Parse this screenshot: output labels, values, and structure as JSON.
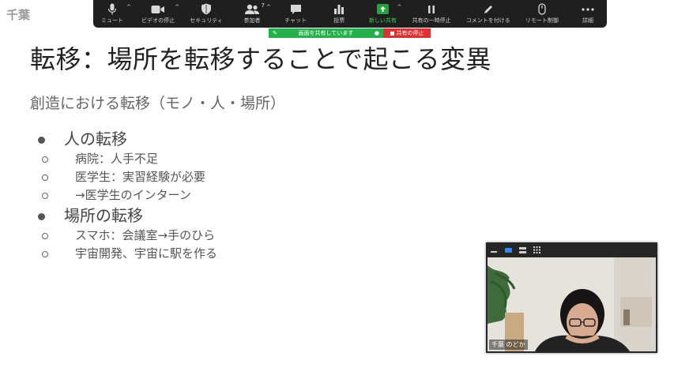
{
  "screen_owner": "千葉",
  "toolbar": {
    "items": [
      {
        "label": "ミュート",
        "icon": "microphone-icon",
        "caret": true
      },
      {
        "label": "ビデオの停止",
        "icon": "video-camera-icon",
        "caret": true
      },
      {
        "label": "セキュリティ",
        "icon": "shield-icon"
      },
      {
        "label": "参加者",
        "icon": "participants-icon",
        "badge": "7",
        "caret": true
      },
      {
        "label": "チャット",
        "icon": "chat-icon"
      },
      {
        "label": "投票",
        "icon": "poll-icon"
      },
      {
        "label": "新しい共有",
        "icon": "share-screen-icon",
        "caret": true
      },
      {
        "label": "共有の一時停止",
        "icon": "pause-icon"
      },
      {
        "label": "コメントを付ける",
        "icon": "annotate-pen-icon"
      },
      {
        "label": "リモート制御",
        "icon": "remote-control-icon"
      },
      {
        "label": "詳細",
        "icon": "more-icon"
      }
    ]
  },
  "sharing_banner": {
    "status": "画面を共有しています",
    "stop_label": "共有の停止"
  },
  "slide": {
    "title": "転移：場所を転移することで起こる変異",
    "subtitle": "創造における転移（モノ・人・場所）",
    "bullets": [
      {
        "text": "人の転移",
        "subs": [
          "病院：人手不足",
          "医学生：実習経験が必要",
          "→医学生のインターン"
        ]
      },
      {
        "text": "場所の転移",
        "subs": [
          "スマホ：会議室→手のひら",
          "宇宙開発、宇宙に駅を作る"
        ]
      }
    ]
  },
  "video_panel": {
    "participant_name": "千葉 のどか",
    "view_controls": [
      "minimize-icon",
      "speaker-view-icon",
      "strip-view-icon",
      "gallery-view-icon"
    ]
  },
  "colors": {
    "toolbar_bg": "#1f1f1f",
    "share_green": "#23a43c",
    "stop_red": "#e02f2f"
  }
}
